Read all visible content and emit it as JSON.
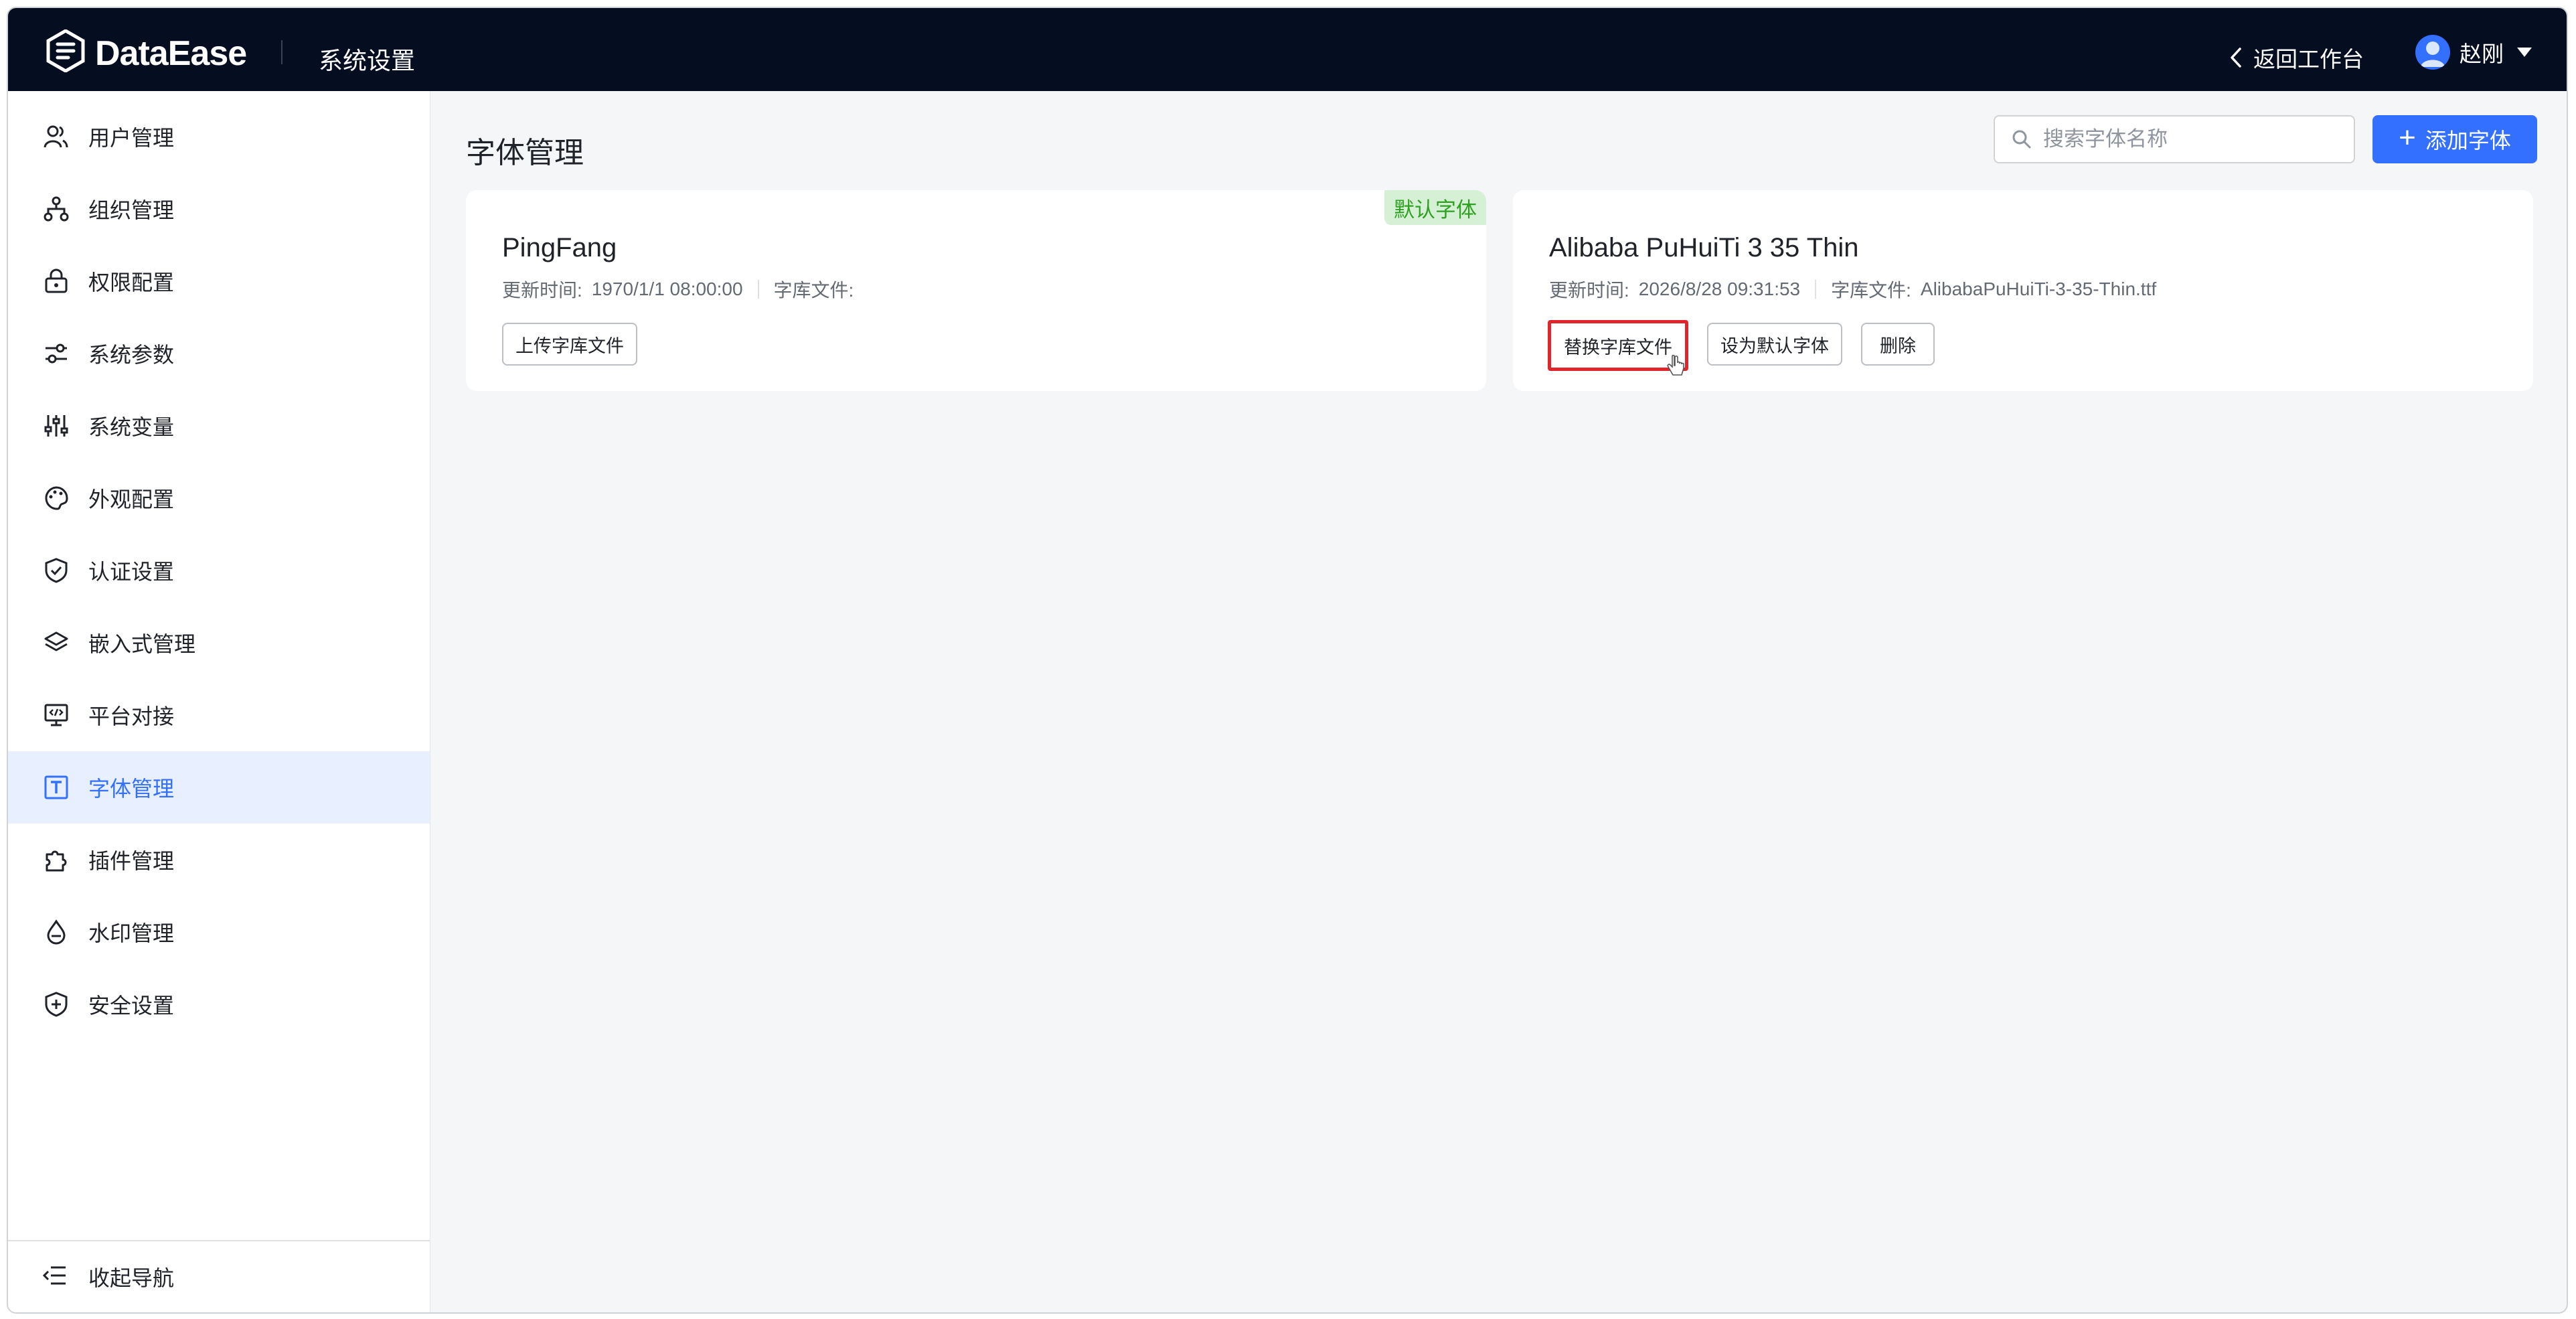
{
  "header": {
    "brand": "DataEase",
    "section_title": "系统设置",
    "back_label": "返回工作台",
    "user_name": "赵刚"
  },
  "sidebar": {
    "items": [
      {
        "label": "用户管理",
        "icon": "users-icon"
      },
      {
        "label": "组织管理",
        "icon": "org-tree-icon"
      },
      {
        "label": "权限配置",
        "icon": "lock-icon"
      },
      {
        "label": "系统参数",
        "icon": "sliders-icon"
      },
      {
        "label": "系统变量",
        "icon": "variables-icon"
      },
      {
        "label": "外观配置",
        "icon": "palette-icon"
      },
      {
        "label": "认证设置",
        "icon": "shield-check-icon"
      },
      {
        "label": "嵌入式管理",
        "icon": "layers-icon"
      },
      {
        "label": "平台对接",
        "icon": "monitor-code-icon"
      },
      {
        "label": "字体管理",
        "icon": "font-icon",
        "active": true
      },
      {
        "label": "插件管理",
        "icon": "puzzle-icon"
      },
      {
        "label": "水印管理",
        "icon": "droplet-icon"
      },
      {
        "label": "安全设置",
        "icon": "shield-plus-icon"
      }
    ],
    "collapse_label": "收起导航"
  },
  "main": {
    "title": "字体管理",
    "search": {
      "placeholder": "搜索字体名称",
      "value": ""
    },
    "add_label": "添加字体",
    "cards": [
      {
        "name": "PingFang",
        "updated_label": "更新时间:",
        "updated_value": "1970/1/1 08:00:00",
        "file_label": "字库文件:",
        "file_value": "",
        "badge": "默认字体",
        "buttons": [
          "上传字库文件"
        ]
      },
      {
        "name": "Alibaba PuHuiTi 3 35 Thin",
        "updated_label": "更新时间:",
        "updated_value": "2026/8/28 09:31:53",
        "file_label": "字库文件:",
        "file_value": "AlibabaPuHuiTi-3-35-Thin.ttf",
        "buttons": [
          "替换字库文件",
          "设为默认字体",
          "删除"
        ]
      }
    ]
  },
  "colors": {
    "topbar": "#050e21",
    "accent": "#3370ff",
    "active_bg": "#e8efff",
    "badge_bg": "#d6f0d6",
    "badge_text": "#2ea121",
    "highlight": "#e0252b"
  }
}
